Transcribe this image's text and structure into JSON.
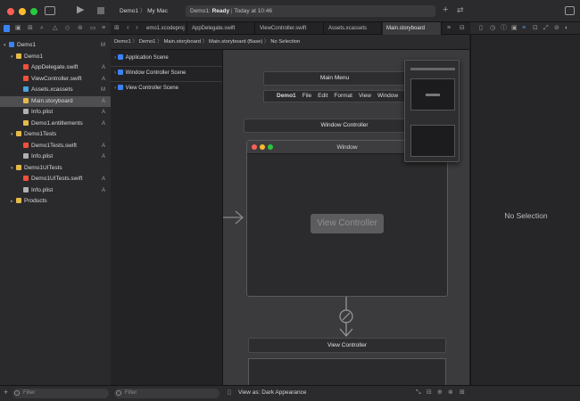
{
  "toolbar": {
    "scheme": "Demo1",
    "destination": "My Mac",
    "status_app": "Demo1:",
    "status_state": "Ready",
    "status_time": "Today at 10:46"
  },
  "tabs": [
    {
      "label": "emo1.xcodeproj",
      "active": false
    },
    {
      "label": "AppDelegate.swift",
      "active": false
    },
    {
      "label": "ViewController.swift",
      "active": false
    },
    {
      "label": "Assets.xcassets",
      "active": false
    },
    {
      "label": "Main.storyboard",
      "active": true
    }
  ],
  "jumpbar": [
    "Demo1",
    "Demo1",
    "Main.storyboard",
    "Main.storyboard (Base)",
    "No Selection"
  ],
  "navigator": {
    "items": [
      {
        "label": "Demo1",
        "badge": "M",
        "level": 0,
        "disclosure": "▾",
        "icon_color": "#3b82f6",
        "selected": false
      },
      {
        "label": "Demo1",
        "badge": "",
        "level": 1,
        "disclosure": "▾",
        "icon_color": "#e5b94a",
        "selected": false
      },
      {
        "label": "AppDelegate.swift",
        "badge": "A",
        "level": 2,
        "disclosure": "",
        "icon_color": "#f05138",
        "selected": false
      },
      {
        "label": "ViewController.swift",
        "badge": "A",
        "level": 2,
        "disclosure": "",
        "icon_color": "#f05138",
        "selected": false
      },
      {
        "label": "Assets.xcassets",
        "badge": "M",
        "level": 2,
        "disclosure": "",
        "icon_color": "#4aa3df",
        "selected": false
      },
      {
        "label": "Main.storyboard",
        "badge": "A",
        "level": 2,
        "disclosure": "",
        "icon_color": "#e5b94a",
        "selected": true
      },
      {
        "label": "Info.plist",
        "badge": "A",
        "level": 2,
        "disclosure": "",
        "icon_color": "#b0b0b0",
        "selected": false
      },
      {
        "label": "Demo1.entitlements",
        "badge": "A",
        "level": 2,
        "disclosure": "",
        "icon_color": "#e5b94a",
        "selected": false
      },
      {
        "label": "Demo1Tests",
        "badge": "",
        "level": 1,
        "disclosure": "▾",
        "icon_color": "#e5b94a",
        "selected": false
      },
      {
        "label": "Demo1Tests.swift",
        "badge": "A",
        "level": 2,
        "disclosure": "",
        "icon_color": "#f05138",
        "selected": false
      },
      {
        "label": "Info.plist",
        "badge": "A",
        "level": 2,
        "disclosure": "",
        "icon_color": "#b0b0b0",
        "selected": false
      },
      {
        "label": "Demo1UITests",
        "badge": "",
        "level": 1,
        "disclosure": "▾",
        "icon_color": "#e5b94a",
        "selected": false
      },
      {
        "label": "Demo1UITests.swift",
        "badge": "A",
        "level": 2,
        "disclosure": "",
        "icon_color": "#f05138",
        "selected": false
      },
      {
        "label": "Info.plist",
        "badge": "A",
        "level": 2,
        "disclosure": "",
        "icon_color": "#b0b0b0",
        "selected": false
      },
      {
        "label": "Products",
        "badge": "",
        "level": 1,
        "disclosure": "▸",
        "icon_color": "#e5b94a",
        "selected": false
      }
    ],
    "filter_placeholder": "Filter"
  },
  "outline": {
    "items": [
      "Application Scene",
      "Window Controller Scene",
      "View Controller Scene"
    ],
    "filter_placeholder": "Filter"
  },
  "canvas": {
    "main_menu_title": "Main Menu",
    "menu_items": [
      "Demo1",
      "File",
      "Edit",
      "Format",
      "View",
      "Window"
    ],
    "window_controller_title": "Window Controller",
    "window_title": "Window",
    "view_controller_label": "View Controller",
    "view_controller_title": "View Controller"
  },
  "inspector": {
    "empty_label": "No Selection"
  },
  "bottom": {
    "view_as": "View as: Dark Appearance"
  },
  "colors": {
    "accent": "#3b82f6",
    "selection": "#4f4f52"
  }
}
